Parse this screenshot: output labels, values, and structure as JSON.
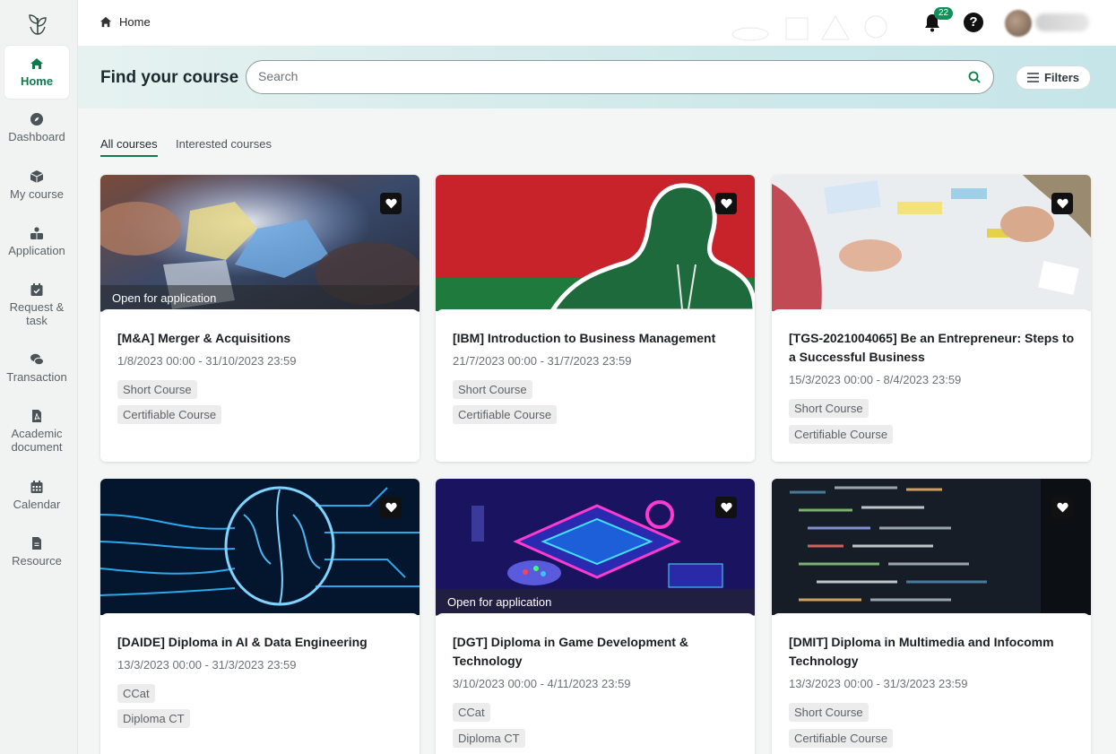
{
  "sidebar": {
    "items": [
      {
        "label": "Home",
        "icon": "home-icon",
        "active": true
      },
      {
        "label": "Dashboard",
        "icon": "compass-icon"
      },
      {
        "label": "My course",
        "icon": "cube-icon"
      },
      {
        "label": "Application",
        "icon": "people-icon"
      },
      {
        "label": "Request & task",
        "icon": "calendar-check-icon"
      },
      {
        "label": "Transaction",
        "icon": "chat-icon"
      },
      {
        "label": "Academic document",
        "icon": "pdf-icon"
      },
      {
        "label": "Calendar",
        "icon": "calendar-icon"
      },
      {
        "label": "Resource",
        "icon": "file-icon"
      }
    ]
  },
  "header": {
    "breadcrumb": "Home",
    "notification_count": "22"
  },
  "banner": {
    "title": "Find your course",
    "search_placeholder": "Search",
    "filters_label": "Filters"
  },
  "tabs": [
    {
      "label": "All courses",
      "active": true
    },
    {
      "label": "Interested courses"
    }
  ],
  "courses": [
    {
      "title": "[M&A] Merger & Acquisitions",
      "dates": "1/8/2023 00:00 - 31/10/2023 23:59",
      "tags": [
        "Short Course",
        "Certifiable Course"
      ],
      "status": "Open for application"
    },
    {
      "title": "[IBM] Introduction to Business Management",
      "dates": "21/7/2023 00:00 - 31/7/2023 23:59",
      "tags": [
        "Short Course",
        "Certifiable Course"
      ]
    },
    {
      "title": "[TGS-2021004065] Be an Entrepreneur: Steps to a Successful Business",
      "dates": "15/3/2023 00:00 - 8/4/2023 23:59",
      "tags": [
        "Short Course",
        "Certifiable Course"
      ]
    },
    {
      "title": "[DAIDE] Diploma in AI & Data Engineering",
      "dates": "13/3/2023 00:00 - 31/3/2023 23:59",
      "tags": [
        "CCat",
        "Diploma CT"
      ]
    },
    {
      "title": "[DGT] Diploma in Game Development & Technology",
      "dates": "3/10/2023 00:00 - 4/11/2023 23:59",
      "tags": [
        "CCat",
        "Diploma CT"
      ],
      "status": "Open for application"
    },
    {
      "title": "[DMIT] Diploma in Multimedia and Infocomm Technology",
      "dates": "13/3/2023 00:00 - 31/3/2023 23:59",
      "tags": [
        "Short Course",
        "Certifiable Course"
      ]
    }
  ],
  "colors": {
    "accent": "#0f7a4c",
    "badge": "#12905a"
  }
}
